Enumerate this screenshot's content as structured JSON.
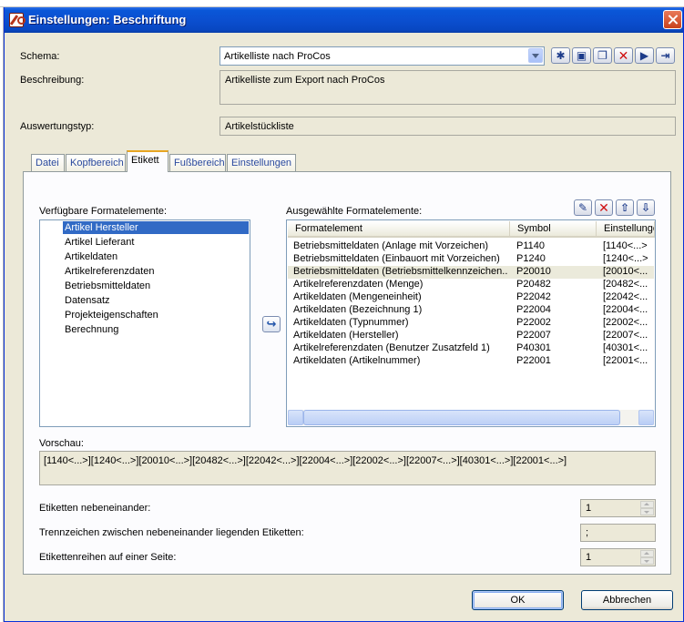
{
  "window": {
    "title": "Einstellungen: Beschriftung"
  },
  "schema": {
    "label": "Schema:",
    "value": "Artikelliste nach ProCos",
    "toolbar_icons": [
      "new-icon",
      "save-icon",
      "copy-icon",
      "delete-icon",
      "import-icon",
      "export-icon"
    ]
  },
  "beschreibung": {
    "label": "Beschreibung:",
    "value": "Artikelliste zum Export nach ProCos"
  },
  "auswertungstyp": {
    "label": "Auswertungstyp:",
    "value": "Artikelstückliste"
  },
  "tabs": [
    {
      "label": "Datei",
      "active": false
    },
    {
      "label": "Kopfbereich",
      "active": false
    },
    {
      "label": "Etikett",
      "active": true
    },
    {
      "label": "Fußbereich",
      "active": false
    },
    {
      "label": "Einstellungen",
      "active": false
    }
  ],
  "available": {
    "label": "Verfügbare Formatelemente:",
    "items": [
      "Artikel Hersteller",
      "Artikel Lieferant",
      "Artikeldaten",
      "Artikelreferenzdaten",
      "Betriebsmitteldaten",
      "Datensatz",
      "Projekteigenschaften",
      "Berechnung"
    ],
    "selected_index": 0
  },
  "selected": {
    "label": "Ausgewählte Formatelemente:",
    "columns": [
      "Formatelement",
      "Symbol",
      "Einstellunge"
    ],
    "rows": [
      {
        "element": "Betriebsmitteldaten (Anlage mit Vorzeichen)",
        "symbol": "P1140",
        "setting": "[1140<...>"
      },
      {
        "element": "Betriebsmitteldaten (Einbauort mit Vorzeichen)",
        "symbol": "P1240",
        "setting": "[1240<...>"
      },
      {
        "element": "Betriebsmitteldaten (Betriebsmittelkennzeichen...",
        "symbol": "P20010",
        "setting": "[20010<..."
      },
      {
        "element": "Artikelreferenzdaten (Menge)",
        "symbol": "P20482",
        "setting": "[20482<..."
      },
      {
        "element": "Artikeldaten (Mengeneinheit)",
        "symbol": "P22042",
        "setting": "[22042<..."
      },
      {
        "element": "Artikeldaten (Bezeichnung 1)",
        "symbol": "P22004",
        "setting": "[22004<..."
      },
      {
        "element": "Artikeldaten (Typnummer)",
        "symbol": "P22002",
        "setting": "[22002<..."
      },
      {
        "element": "Artikeldaten (Hersteller)",
        "symbol": "P22007",
        "setting": "[22007<..."
      },
      {
        "element": "Artikelreferenzdaten (Benutzer Zusatzfeld 1)",
        "symbol": "P40301",
        "setting": "[40301<..."
      },
      {
        "element": "Artikeldaten (Artikelnummer)",
        "symbol": "P22001",
        "setting": "[22001<..."
      }
    ],
    "highlighted_index": 2,
    "toolbar_icons": [
      "edit-icon",
      "remove-icon",
      "move-up-icon",
      "move-down-icon"
    ]
  },
  "preview": {
    "label": "Vorschau:",
    "value": "[1140<...>][1240<...>][20010<...>][20482<...>][22042<...>][22004<...>][22002<...>][22007<...>][40301<...>][22001<...>]"
  },
  "settings": {
    "nebeneinander_label": "Etiketten nebeneinander:",
    "nebeneinander_value": "1",
    "trennzeichen_label": "Trennzeichen zwischen nebeneinander liegenden Etiketten:",
    "trennzeichen_value": ";",
    "reihen_label": "Etikettenreihen auf einer Seite:",
    "reihen_value": "1"
  },
  "buttons": {
    "ok": "OK",
    "cancel": "Abbrechen"
  }
}
